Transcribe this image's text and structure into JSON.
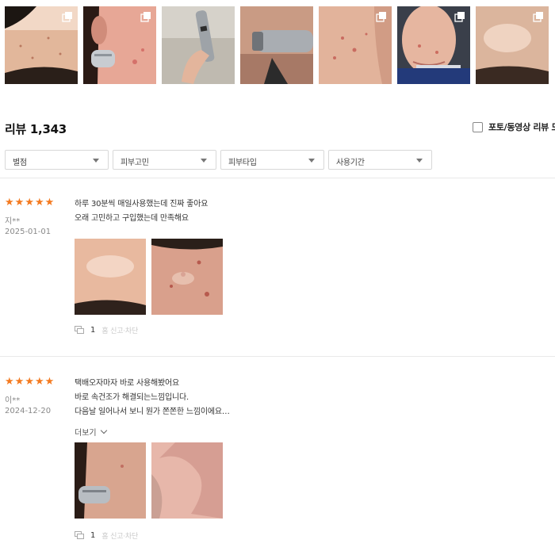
{
  "gallery": {
    "thumbnails": [
      {
        "icon": "multi-image-icon",
        "has_multi": true
      },
      {
        "icon": "multi-image-icon",
        "has_multi": true
      },
      {
        "icon": "",
        "has_multi": false
      },
      {
        "icon": "",
        "has_multi": false
      },
      {
        "icon": "multi-image-icon",
        "has_multi": true
      },
      {
        "icon": "multi-image-icon",
        "has_multi": true
      },
      {
        "icon": "multi-image-icon",
        "has_multi": true
      }
    ]
  },
  "header": {
    "title": "리뷰 1,343",
    "photo_filter_label": "포토/동영상 리뷰 모"
  },
  "filters": [
    "별점",
    "피부고민",
    "피부타입",
    "사용기간"
  ],
  "reviews": [
    {
      "rating": 5,
      "author": "지**",
      "date": "2025-01-01",
      "lines": [
        "하루 30분씩 매일사용했는데 진짜 좋아요",
        "오래 고민하고 구입했는데 만족해요"
      ],
      "more": "",
      "comment_count": "1",
      "report": "홈 신고·차단"
    },
    {
      "rating": 5,
      "author": "이**",
      "date": "2024-12-20",
      "lines": [
        "택배오자마자 바로 사용해봤어요",
        "바로 속건조가 해결되는느낌입니다.",
        "다음날 일어나서 보니 뭔가 쫀쫀한 느낌이에요…"
      ],
      "more": "더보기",
      "comment_count": "1",
      "report": "홈 신고·차단"
    }
  ],
  "colors": {
    "star": "#f47a20",
    "divider": "#e9e9e9",
    "muted": "#888888"
  }
}
